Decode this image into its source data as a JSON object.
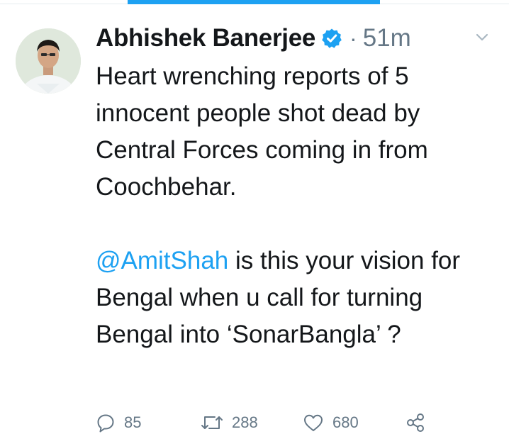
{
  "colors": {
    "accent": "#1da1f2",
    "text": "#14171a",
    "muted": "#657786"
  },
  "tweet": {
    "author": {
      "name": "Abhishek Banerjee",
      "verified": true,
      "avatar_icon": "avatar-photo"
    },
    "separator": "·",
    "time": "51m",
    "menu_icon": "chevron-down-icon",
    "paragraphs": [
      {
        "text": "Heart wrenching reports of 5 innocent people shot dead by Central Forces coming in from Coochbehar."
      },
      {
        "mention": "@AmitShah",
        "text": " is this your vision for Bengal when u call for turning Bengal into ‘SonarBangla’ ?"
      }
    ],
    "actions": {
      "replies": "85",
      "retweets": "288",
      "likes": "680",
      "reply_icon": "reply-icon",
      "retweet_icon": "retweet-icon",
      "like_icon": "heart-icon",
      "share_icon": "share-icon"
    }
  }
}
